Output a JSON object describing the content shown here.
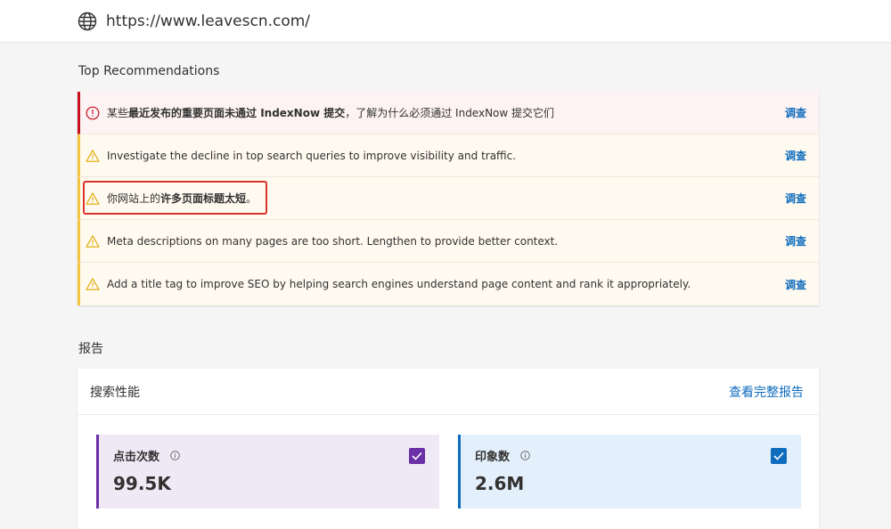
{
  "site": {
    "url": "https://www.leavescn.com/",
    "icon": "globe-icon"
  },
  "recommendations": {
    "title": "Top Recommendations",
    "items": [
      {
        "severity": "error",
        "icon": "error-circle-icon",
        "text_pre": "某些",
        "text_bold": "最近发布的重要页面未通过 IndexNow 提交",
        "text_post": "，了解为什么必须通过 IndexNow 提交它们",
        "action": "调查"
      },
      {
        "severity": "warning",
        "icon": "warning-icon",
        "text_pre": "Investigate the decline in top search queries to improve visibility and traffic.",
        "text_bold": "",
        "text_post": "",
        "action": "调查"
      },
      {
        "severity": "warning",
        "icon": "warning-icon",
        "text_pre": "你网站上的",
        "text_bold": "许多页面标题太短",
        "text_post": "。",
        "action": "调查"
      },
      {
        "severity": "warning",
        "icon": "warning-icon",
        "text_pre": "Meta descriptions on many pages are too short. Lengthen to provide better context.",
        "text_bold": "",
        "text_post": "",
        "action": "调查"
      },
      {
        "severity": "warning",
        "icon": "warning-icon",
        "text_pre": "Add a title tag to improve SEO by helping search engines understand page content and rank it appropriately.",
        "text_bold": "",
        "text_post": "",
        "action": "调查"
      }
    ]
  },
  "report": {
    "title": "报告",
    "card_title": "搜索性能",
    "full_report_link": "查看完整报告",
    "metrics": [
      {
        "label": "点击次数",
        "value": "99.5K",
        "checked": true,
        "color": "#6b2fa8"
      },
      {
        "label": "印象数",
        "value": "2.6M",
        "checked": true,
        "color": "#0f6cbd"
      }
    ]
  },
  "colors": {
    "accent": "#0f6cbd",
    "error": "#c50f1f",
    "warning": "#f5c542",
    "highlight": "#d9342b"
  }
}
